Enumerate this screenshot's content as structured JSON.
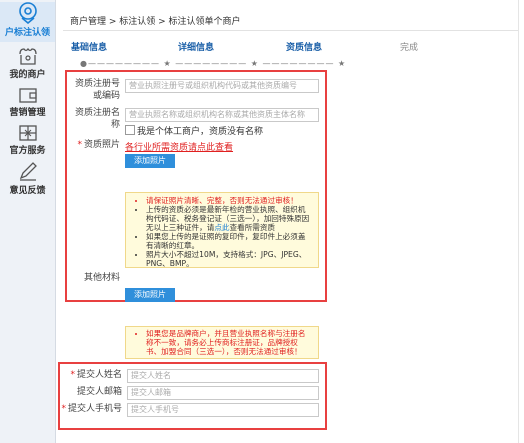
{
  "sidebar": {
    "items": [
      {
        "label": "户标注认领",
        "icon": "location-pin-icon",
        "active": true
      },
      {
        "label": "我的商户",
        "icon": "shop-icon",
        "active": false
      },
      {
        "label": "营销管理",
        "icon": "wallet-icon",
        "active": false
      },
      {
        "label": "官方服务",
        "icon": "service-grid-icon",
        "active": false
      },
      {
        "label": "意见反馈",
        "icon": "pencil-icon",
        "active": false
      }
    ]
  },
  "breadcrumb": "商户管理 > 标注认领 > 标注认领单个商户",
  "steps": {
    "items": [
      {
        "label": "基础信息"
      },
      {
        "label": "详细信息"
      },
      {
        "label": "资质信息"
      },
      {
        "label": "完成"
      }
    ],
    "connector": "●———————— ★ ———————— ★ ———————— ★"
  },
  "form": {
    "reg_no_label": "资质注册号或编码",
    "reg_no_placeholder": "营业执照注册号或组织机构代码或其他资质编号",
    "reg_name_label": "资质注册名称",
    "reg_name_placeholder": "营业执照名称或组织机构名称或其他资质主体名称",
    "individual_checkbox": "我是个体工商户，资质没有名称",
    "photo_label": "资质照片",
    "industry_link": "各行业所需资质请点此查看",
    "add_photo_button": "添加照片",
    "notice1": {
      "warn_line": "请保证照片清晰、完整，否则无法通过审核！",
      "line2_a": "上传的资质必须是最新年检的营业执照、组织机构代码证、税务登记证（三选一），加回特殊原因无以上三种证件，请",
      "line2_link": "点此",
      "line2_b": "查看所需资质",
      "line3": "如果您上传的是证照的复印件，复印件上必须盖有清晰的红章。",
      "line4": "照片大小不超过10M，支持格式：JPG、JPEG、PNG、BMP。"
    },
    "other_label": "其他材料",
    "add_photo_button2": "添加照片",
    "notice2": "如果您是品牌商户，并且营业执照名称与注册名称不一致，请务必上传商标注册证，品牌授权书、加盟合同（三选一），否则无法通过审核！",
    "submitter_name_label": "提交人姓名",
    "submitter_name_placeholder": "提交人姓名",
    "submitter_email_label": "提交人邮箱",
    "submitter_email_placeholder": "提交人邮箱",
    "submitter_phone_label": "提交人手机号",
    "submitter_phone_placeholder": "提交人手机号"
  },
  "colors": {
    "accent": "#2f8fdb",
    "highlight_box": "#e84040",
    "required": "#e02020",
    "step_active": "#1a5fa8"
  }
}
